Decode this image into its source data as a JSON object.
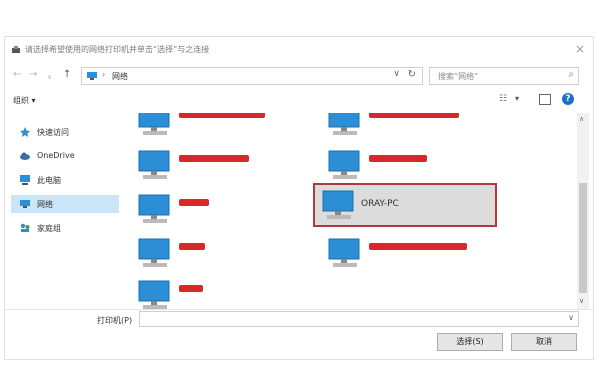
{
  "dialog": {
    "title": "请选择希望使用的网络打印机并单击“选择”与之连接",
    "close_symbol": "×"
  },
  "nav": {
    "back": "←",
    "forward": "→",
    "dropdown": "∨",
    "up": "↑",
    "address_sep": "›",
    "address_crumb": "网络",
    "address_dd": "∨",
    "refresh": "↻",
    "search_placeholder": "搜索“网络”",
    "search_icon": "⌕"
  },
  "toolbar": {
    "organize": "组织 ▾",
    "view_icon": "☷",
    "view_dd": "▾",
    "help": "?"
  },
  "sidebar": {
    "items": [
      {
        "label": "快速访问",
        "icon": "star-icon"
      },
      {
        "label": "OneDrive",
        "icon": "cloud-icon"
      },
      {
        "label": "此电脑",
        "icon": "computer-icon"
      },
      {
        "label": "网络",
        "icon": "network-icon",
        "selected": true
      },
      {
        "label": "家庭组",
        "icon": "homegroup-icon"
      }
    ]
  },
  "computers": [
    {
      "name": "",
      "redacted": true
    },
    {
      "name": "",
      "redacted": true
    },
    {
      "name": "",
      "redacted": true
    },
    {
      "name": "",
      "redacted": true
    },
    {
      "name": "",
      "redacted": true
    },
    {
      "name": "ORAY-PC",
      "redacted": false,
      "selected": true
    },
    {
      "name": "",
      "redacted": true
    },
    {
      "name": "",
      "redacted": true
    },
    {
      "name": "",
      "redacted": true
    }
  ],
  "scrollbar": {
    "up": "∧",
    "down": "∨"
  },
  "footer": {
    "printer_label": "打印机(P)",
    "printer_value": "",
    "printer_dd": "∨",
    "select_button": "选择(S)",
    "cancel_button": "取消"
  },
  "colors": {
    "accent": "#1f6fc5",
    "selection_border": "#b03a3a",
    "redaction": "#d8282a",
    "monitor": "#2c8fd6"
  }
}
